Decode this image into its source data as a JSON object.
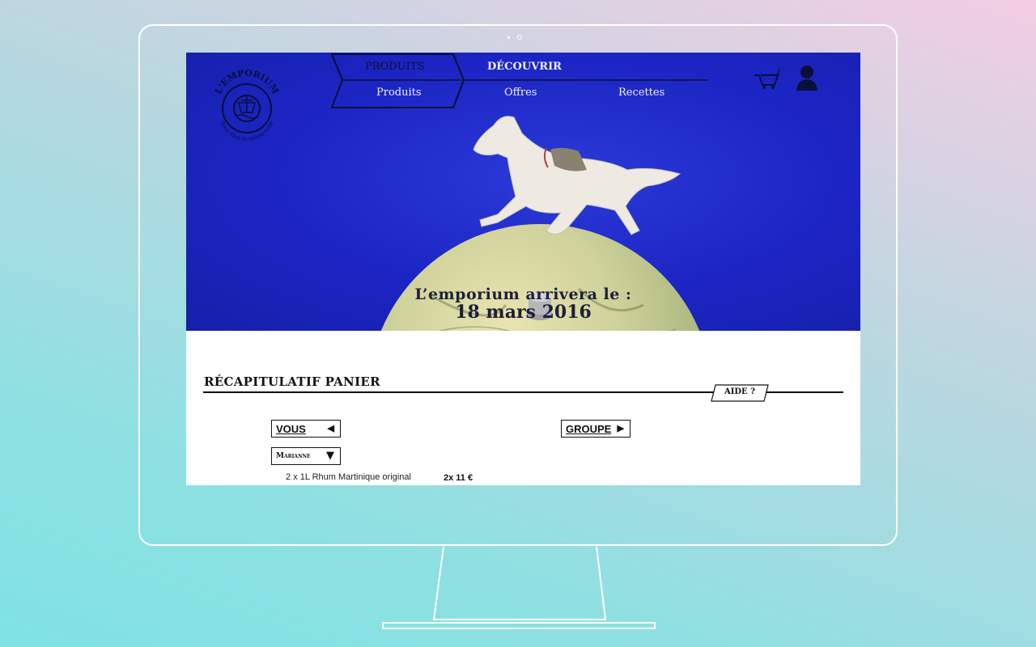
{
  "logo": {
    "arc_text": "L'EMPORIUM",
    "tagline": "Tous sous la même voile"
  },
  "nav": {
    "top_items": [
      "PRODUITS",
      "DÉCOUVRIR"
    ],
    "sub_items": [
      "Produits",
      "Offres",
      "Recettes"
    ]
  },
  "icons": {
    "cart": "shopping-cart-icon",
    "user": "user-account-icon"
  },
  "hero": {
    "line1": "L’emporium arrivera le :",
    "line2": "18 mars 2016"
  },
  "cart": {
    "title": "RÉCAPITULATIF PANIER",
    "help_label": "AIDE ?",
    "vous_label": "VOUS",
    "vous_arrow": "◀",
    "groupe_label": "GROUPE",
    "groupe_arrow": "▶",
    "member_selected": "Marianne",
    "member_arrow": "▼",
    "items": [
      {
        "name": "2 x 1L Rhum Martinique original",
        "price": "2x 11 €"
      }
    ]
  },
  "colors": {
    "hero_blue": "#1c25c4",
    "text_dark": "#111111"
  }
}
